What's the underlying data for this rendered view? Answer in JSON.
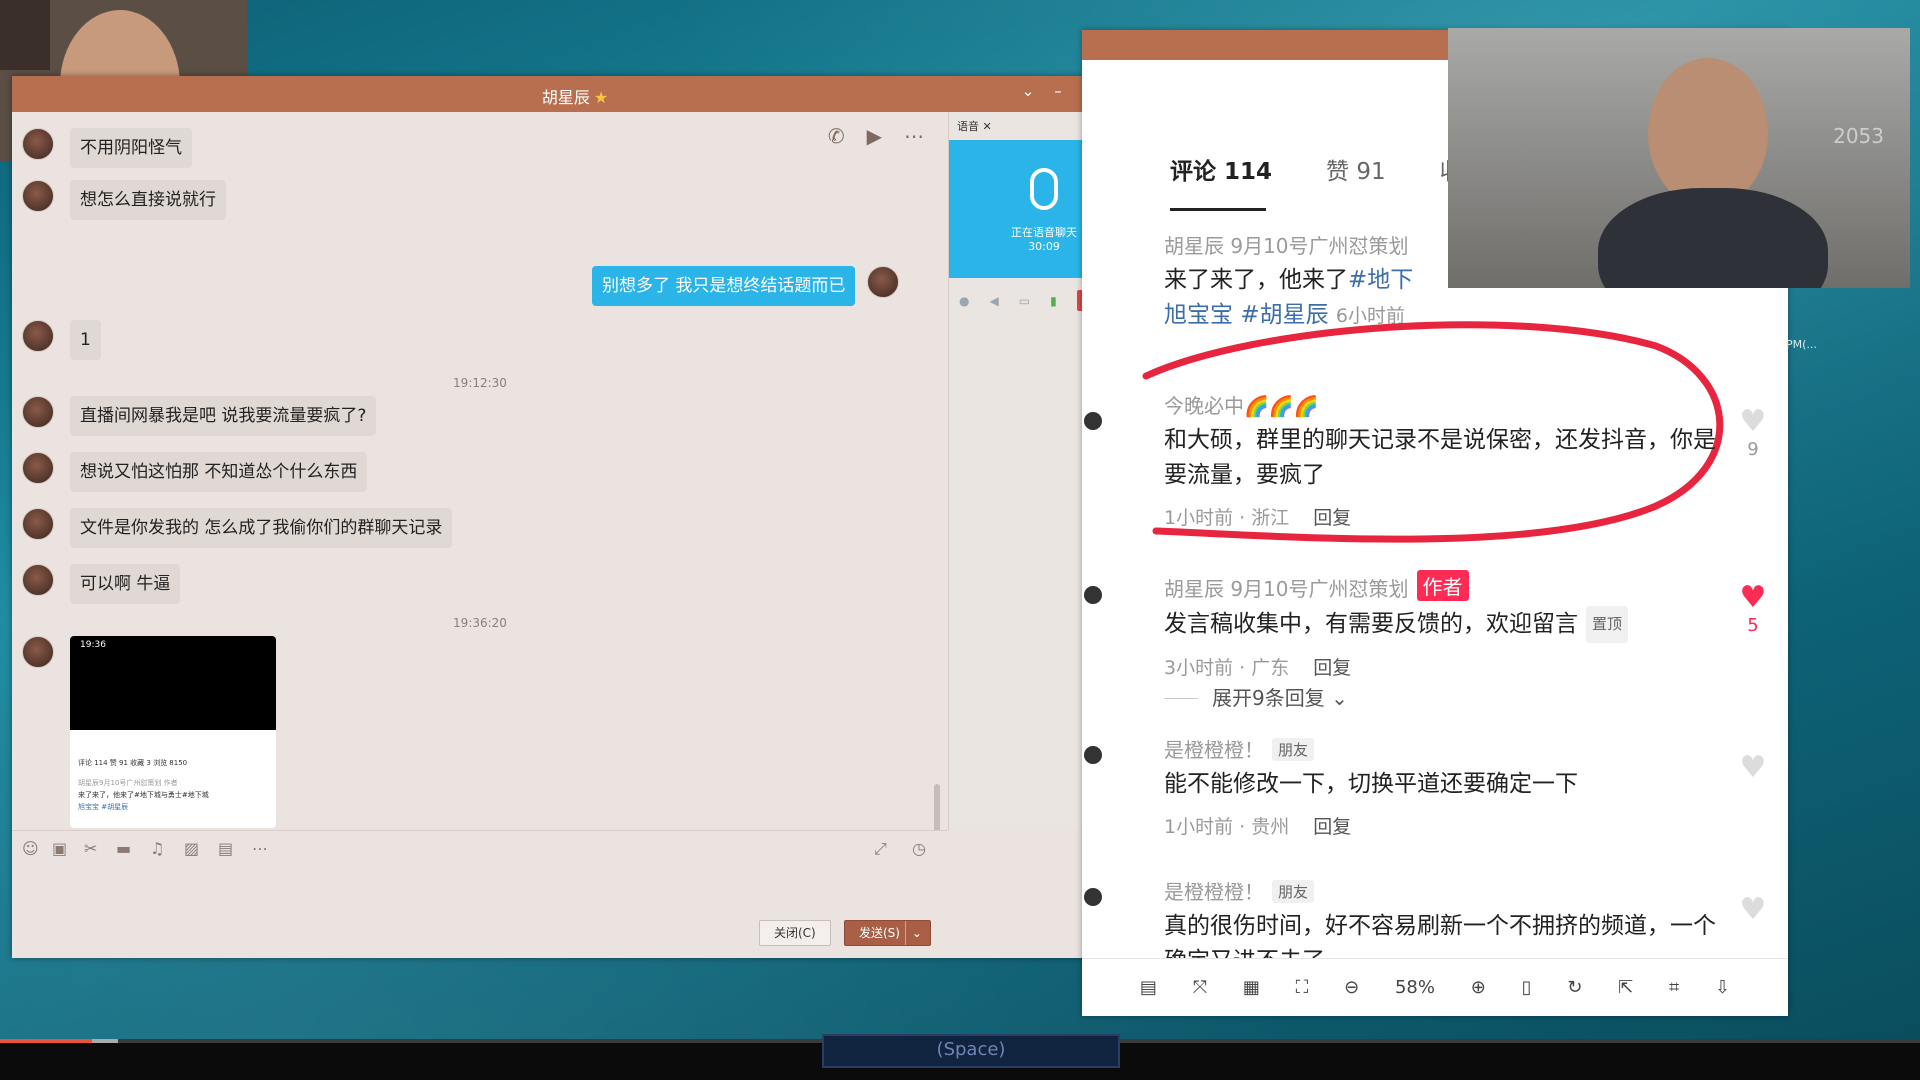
{
  "colors": {
    "accent": "#b86f4f",
    "bubble_right": "#2ab4e8",
    "douyin_red": "#fe2c55"
  },
  "chat": {
    "title": "胡星辰",
    "title_icon": "star-icon",
    "messages": {
      "m1": "不用阴阳怪气",
      "m2": "想怎么直接说就行",
      "m3": "别想多了 我只是想终结话题而已",
      "m4": "1",
      "t1": "19:12:30",
      "m5": "直播间网暴我是吧   说我要流量要疯了?",
      "m6": "想说又怕这怕那  不知道怂个什么东西",
      "m7": "文件是你发我的  怎么成了我偷你们的群聊天记录",
      "m8": "可以啊     牛逼",
      "t2": "19:36:20",
      "thumb_time": "19:36",
      "thumb_tabs": "评论 114     赞 91     收藏 3     浏览 8150",
      "thumb_line1": "胡星辰9月10号广州怼策划  作者",
      "thumb_line2": "来了来了，他来了#地下城与勇士#地下城",
      "thumb_line3": "旭宝宝 #胡星辰"
    },
    "buttons": {
      "close": "关闭(C)",
      "send": "发送(S)"
    }
  },
  "voice": {
    "tab": "语音",
    "status": "正在语音聊天",
    "duration": "30:09",
    "hangup": "挂断"
  },
  "viewer": {
    "tabs": {
      "comments": "评论 114",
      "likes": "赞 91",
      "collect": "收"
    },
    "comments": {
      "c0": {
        "author": "胡星辰 9月10号广州怼策划",
        "text_a": "来了来了，他来了",
        "tag1": "#地下",
        "tag2": "旭宝宝",
        "tag3": "#胡星辰",
        "time": "6小时前"
      },
      "c1": {
        "author": "今晚必中🌈🌈🌈",
        "text": "和大硕，群里的聊天记录不是说保密，还发抖音，你是要流量，要疯了",
        "meta": "1小时前 · 浙江",
        "reply": "回复",
        "likes": "9"
      },
      "c2": {
        "author": "胡星辰 9月10号广州怼策划",
        "badge": "作者",
        "text": "发言稿收集中，有需要反馈的，欢迎留言",
        "pin": "置顶",
        "meta": "3小时前 · 广东",
        "reply": "回复",
        "likes": "5"
      },
      "expand": "展开9条回复",
      "c3": {
        "author": "是橙橙橙！",
        "badge": "朋友",
        "text": "能不能修改一下，切换平道还要确定一下",
        "meta": "1小时前 · 贵州",
        "reply": "回复"
      },
      "c4": {
        "author": "是橙橙橙！",
        "badge": "朋友",
        "text": "真的很伤时间，好不容易刷新一个不拥挤的频道，一个确定又进不去了"
      }
    },
    "zoom": "58%"
  },
  "overlay": {
    "space_key": "(Space)",
    "watermark": "2053",
    "side_note": "PM(..."
  }
}
